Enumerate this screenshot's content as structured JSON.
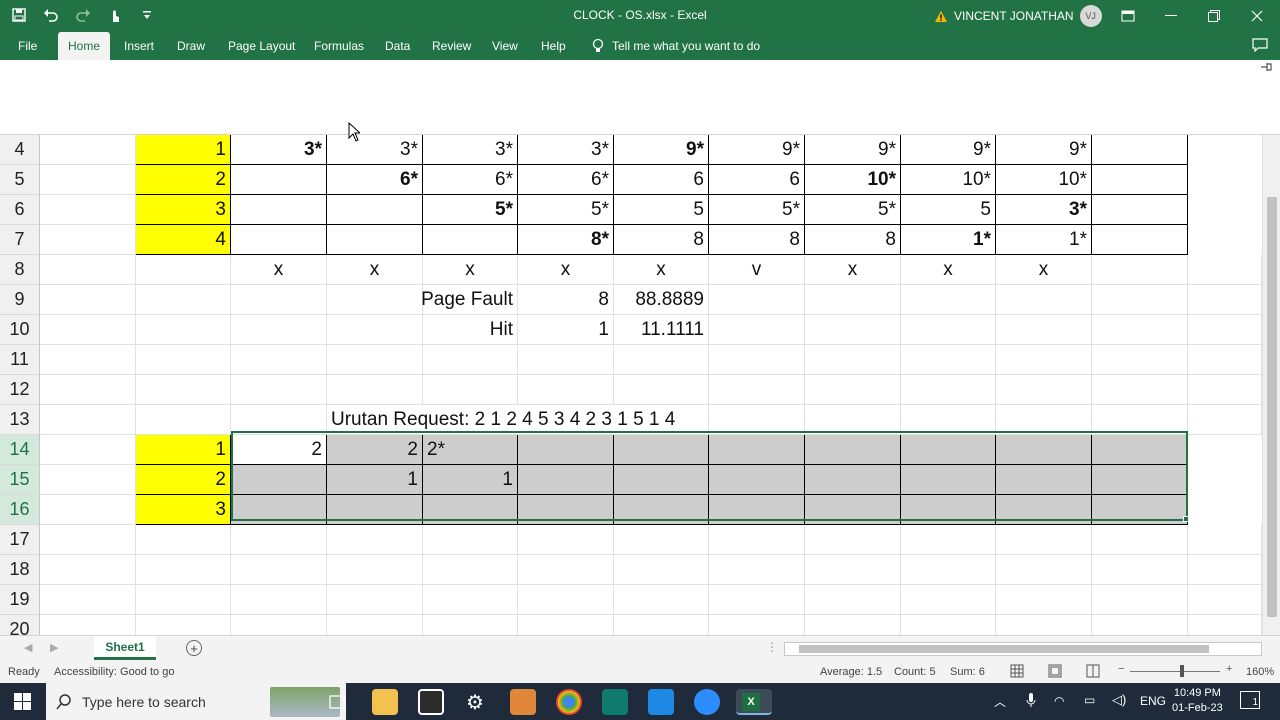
{
  "window": {
    "title": "CLOCK - OS.xlsx  -  Excel",
    "user_name": "VINCENT JONATHAN",
    "user_initials": "VJ"
  },
  "ribbon": {
    "tabs": [
      "File",
      "Home",
      "Insert",
      "Draw",
      "Page Layout",
      "Formulas",
      "Data",
      "Review",
      "View",
      "Help"
    ],
    "active_tab": "Home",
    "tell_me": "Tell me what you want to do"
  },
  "sheet": {
    "row_numbers": [
      "4",
      "5",
      "6",
      "7",
      "8",
      "9",
      "10",
      "11",
      "12",
      "13",
      "14",
      "15",
      "16",
      "17",
      "18",
      "19",
      "20"
    ],
    "rows": {
      "r4": [
        "1",
        "3*",
        "3*",
        "3*",
        "3*",
        "9*",
        "9*",
        "9*",
        "9*",
        "9*"
      ],
      "r5": [
        "2",
        "",
        "6*",
        "6*",
        "6*",
        "6",
        "6",
        "10*",
        "10*",
        "10*"
      ],
      "r6": [
        "3",
        "",
        "",
        "5*",
        "5*",
        "5",
        "5*",
        "5*",
        "5",
        "3*"
      ],
      "r7": [
        "4",
        "",
        "",
        "",
        "8*",
        "8",
        "8",
        "8",
        "1*",
        "1*"
      ],
      "r8": [
        "x",
        "x",
        "x",
        "x",
        "x",
        "v",
        "x",
        "x",
        "x"
      ],
      "r9": {
        "label": "Page Fault",
        "count": "8",
        "percent": "88.8889"
      },
      "r10": {
        "label": "Hit",
        "count": "1",
        "percent": "11.1111"
      },
      "r13": "Urutan Request: 2 1 2 4 5 3 4 2 3 1 5 1 4",
      "r14": [
        "1",
        "2",
        "2",
        "2*"
      ],
      "r15": [
        "2",
        "",
        "1",
        "1"
      ],
      "r16": [
        "3"
      ]
    }
  },
  "sheet_tab": "Sheet1",
  "status": {
    "ready": "Ready",
    "accessibility": "Accessibility: Good to go",
    "average": "Average: 1.5",
    "count": "Count: 5",
    "sum": "Sum: 6",
    "zoom": "160%"
  },
  "taskbar": {
    "search_placeholder": "Type here to search",
    "language": "ENG",
    "time": "10:49 PM",
    "date": "01-Feb-23",
    "notifications": "1"
  }
}
